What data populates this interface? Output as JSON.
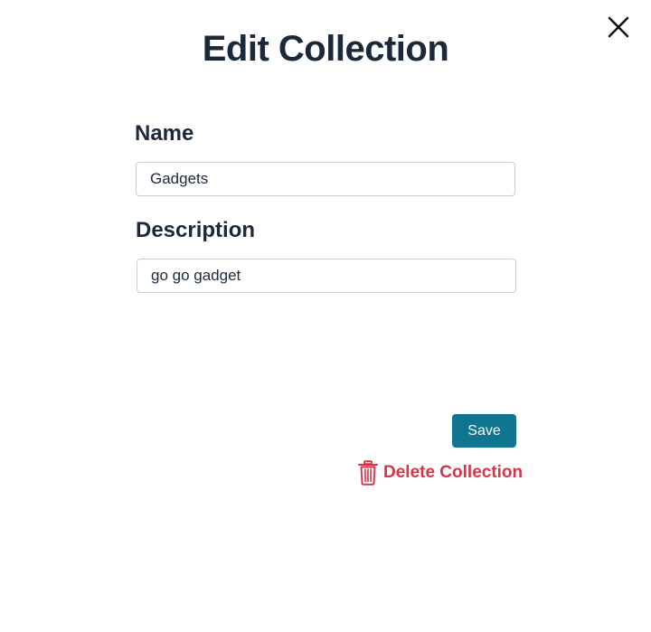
{
  "dialog": {
    "title": "Edit Collection",
    "close_icon": "close-icon"
  },
  "form": {
    "name": {
      "label": "Name",
      "value": "Gadgets"
    },
    "description": {
      "label": "Description",
      "value": "go go gadget"
    }
  },
  "actions": {
    "save_label": "Save",
    "delete_label": "Delete Collection",
    "delete_icon": "trash-icon"
  },
  "colors": {
    "primary": "#0f7590",
    "danger": "#d63548",
    "heading": "#1b2a3a"
  }
}
